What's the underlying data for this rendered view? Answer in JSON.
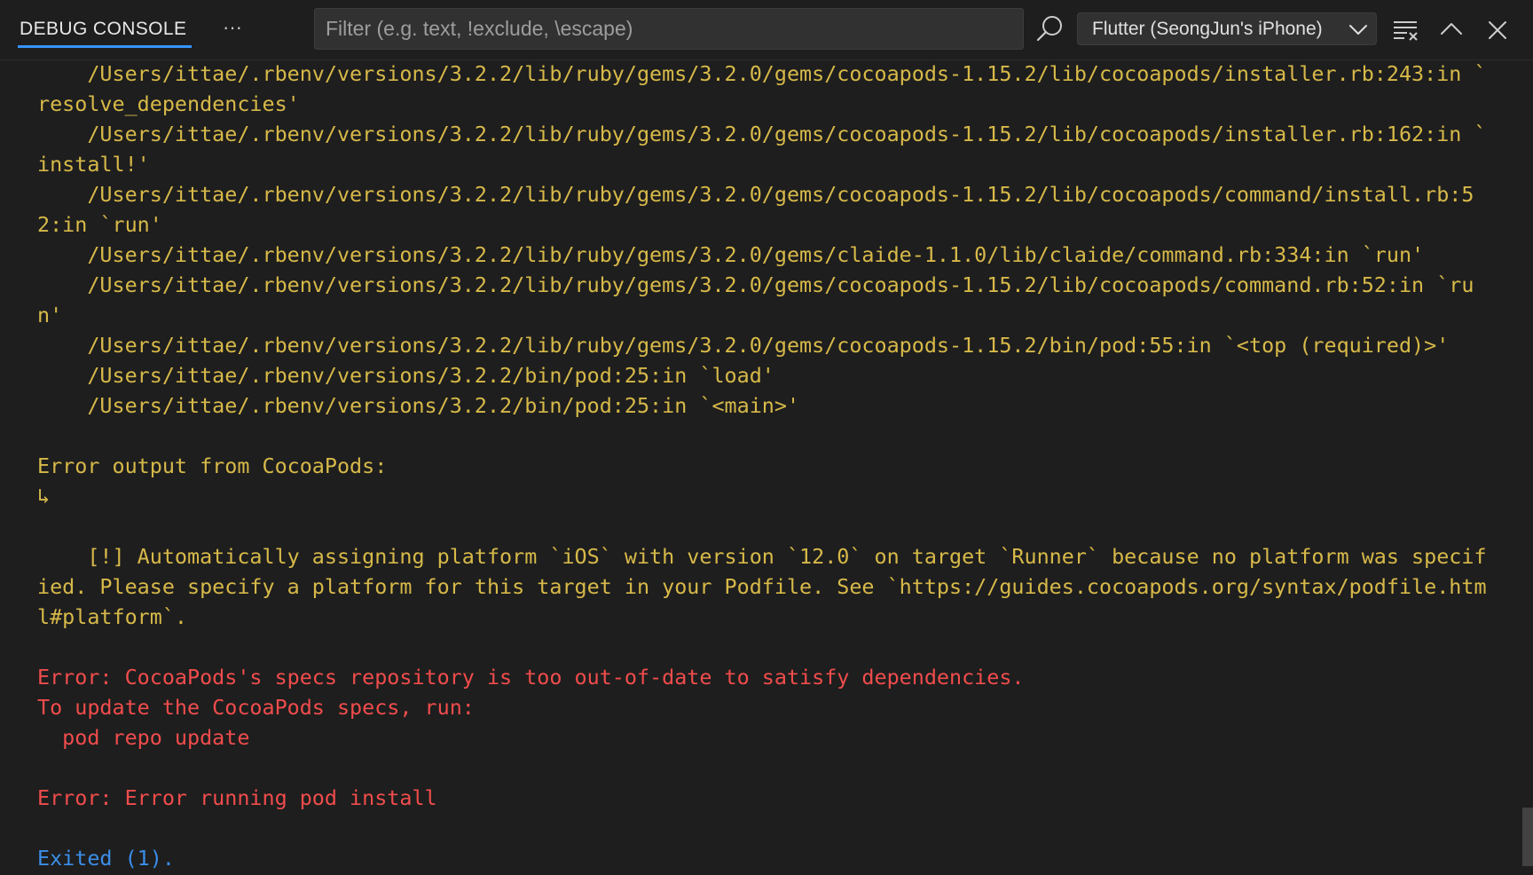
{
  "header": {
    "tab_label": "DEBUG CONSOLE",
    "more_label": "···",
    "filter_placeholder": "Filter (e.g. text, !exclude, \\escape)",
    "filter_value": "",
    "session_label": "Flutter (SeongJun's iPhone)"
  },
  "icons": {
    "search": "search-icon",
    "chevron": "chevron-down-icon",
    "clear": "clear-console-icon",
    "maximize": "chevron-up-icon",
    "close": "close-icon"
  },
  "colors": {
    "background": "#1e1e1e",
    "warning_text": "#d7b949",
    "error_text": "#f14c4c",
    "exit_text": "#3b8eea",
    "tab_underline": "#3794ff"
  },
  "output": {
    "lines": [
      {
        "text": "    /Users/ittae/.rbenv/versions/3.2.2/lib/ruby/gems/3.2.0/gems/cocoapods-1.15.2/lib/cocoapods/installer.rb:243:in `",
        "color": "yellow"
      },
      {
        "text": "resolve_dependencies'",
        "color": "yellow"
      },
      {
        "text": "    /Users/ittae/.rbenv/versions/3.2.2/lib/ruby/gems/3.2.0/gems/cocoapods-1.15.2/lib/cocoapods/installer.rb:162:in `",
        "color": "yellow"
      },
      {
        "text": "install!'",
        "color": "yellow"
      },
      {
        "text": "    /Users/ittae/.rbenv/versions/3.2.2/lib/ruby/gems/3.2.0/gems/cocoapods-1.15.2/lib/cocoapods/command/install.rb:5",
        "color": "yellow"
      },
      {
        "text": "2:in `run'",
        "color": "yellow"
      },
      {
        "text": "    /Users/ittae/.rbenv/versions/3.2.2/lib/ruby/gems/3.2.0/gems/claide-1.1.0/lib/claide/command.rb:334:in `run'",
        "color": "yellow"
      },
      {
        "text": "    /Users/ittae/.rbenv/versions/3.2.2/lib/ruby/gems/3.2.0/gems/cocoapods-1.15.2/lib/cocoapods/command.rb:52:in `ru",
        "color": "yellow"
      },
      {
        "text": "n'",
        "color": "yellow"
      },
      {
        "text": "    /Users/ittae/.rbenv/versions/3.2.2/lib/ruby/gems/3.2.0/gems/cocoapods-1.15.2/bin/pod:55:in `<top (required)>'",
        "color": "yellow"
      },
      {
        "text": "    /Users/ittae/.rbenv/versions/3.2.2/bin/pod:25:in `load'",
        "color": "yellow"
      },
      {
        "text": "    /Users/ittae/.rbenv/versions/3.2.2/bin/pod:25:in `<main>'",
        "color": "yellow"
      },
      {
        "text": "",
        "color": "yellow"
      },
      {
        "text": "Error output from CocoaPods:",
        "color": "yellow"
      },
      {
        "text": "↳",
        "color": "yellow"
      },
      {
        "text": "",
        "color": "yellow"
      },
      {
        "text": "    [!] Automatically assigning platform `iOS` with version `12.0` on target `Runner` because no platform was specif",
        "color": "yellow"
      },
      {
        "text": "ied. Please specify a platform for this target in your Podfile. See `https://guides.cocoapods.org/syntax/podfile.htm",
        "color": "yellow"
      },
      {
        "text": "l#platform`.",
        "color": "yellow"
      },
      {
        "text": "",
        "color": "yellow"
      },
      {
        "text": "Error: CocoaPods's specs repository is too out-of-date to satisfy dependencies.",
        "color": "red"
      },
      {
        "text": "To update the CocoaPods specs, run:",
        "color": "red"
      },
      {
        "text": "  pod repo update",
        "color": "red"
      },
      {
        "text": "",
        "color": "red"
      },
      {
        "text": "Error: Error running pod install",
        "color": "red"
      },
      {
        "text": "",
        "color": "red"
      },
      {
        "text": "Exited (1).",
        "color": "blue"
      }
    ]
  }
}
